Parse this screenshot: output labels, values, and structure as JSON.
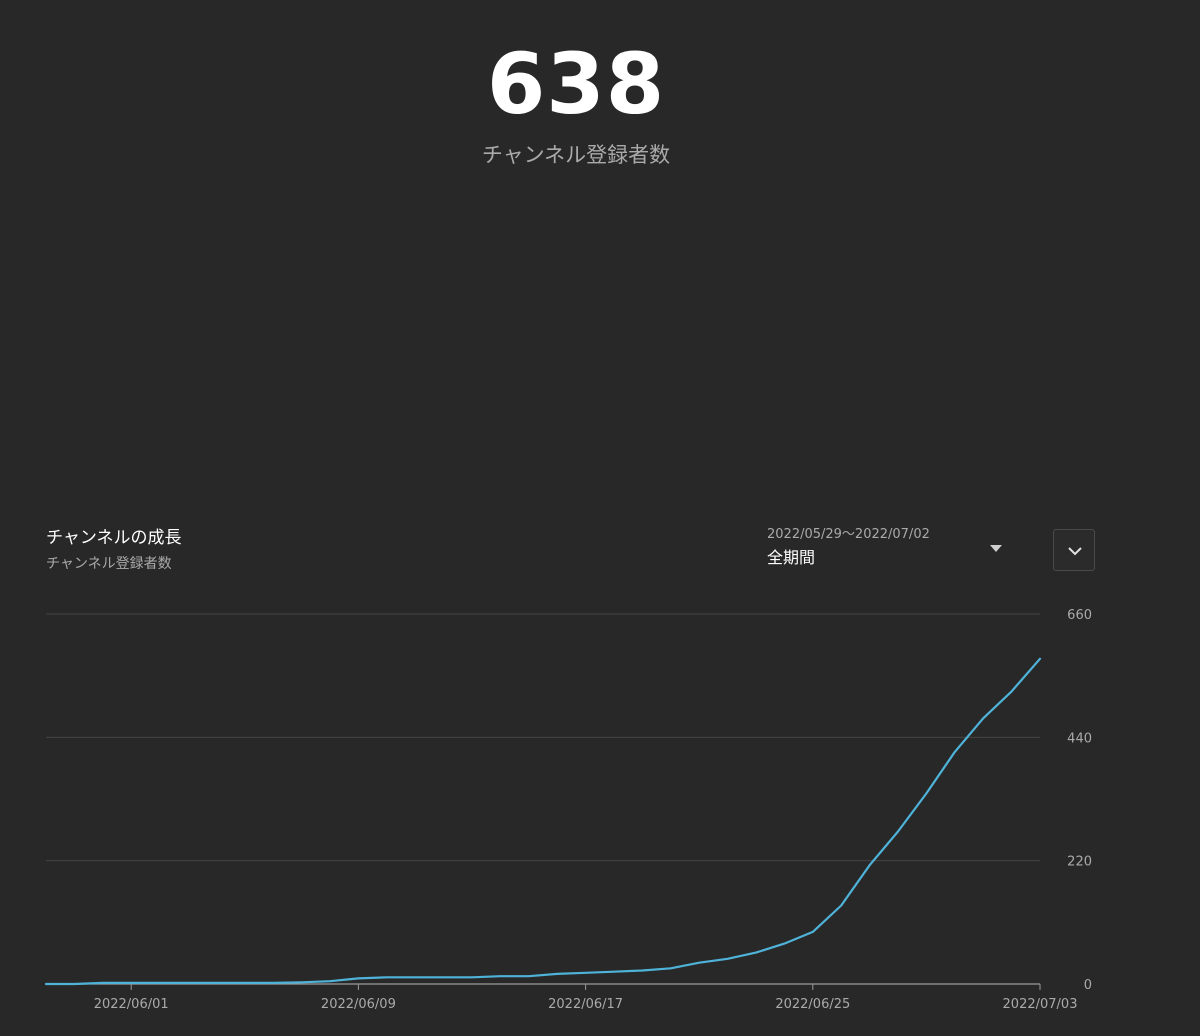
{
  "summary": {
    "value": "638",
    "label": "チャンネル登録者数"
  },
  "card": {
    "title": "チャンネルの成長",
    "subtitle": "チャンネル登録者数"
  },
  "range_select": {
    "dates": "2022/05/29〜2022/07/02",
    "value": "全期間"
  },
  "icons": {
    "range_caret": "caret-down-icon",
    "expand": "chevron-down-icon"
  },
  "colors": {
    "background": "#282828",
    "line": "#4fb3d9",
    "grid": "#444444",
    "axis_text": "#aaaaaa"
  },
  "chart_data": {
    "type": "line",
    "title": "チャンネルの成長",
    "subtitle": "チャンネル登録者数",
    "xlabel": "",
    "ylabel": "",
    "x_tick_labels": [
      "2022/06/01",
      "2022/06/09",
      "2022/06/17",
      "2022/06/25",
      "2022/07/03"
    ],
    "y_ticks": [
      0,
      220,
      440,
      660
    ],
    "ylim": [
      0,
      660
    ],
    "xlim": [
      "2022/05/29",
      "2022/07/03"
    ],
    "y_axis_position": "right",
    "grid": true,
    "legend": "none",
    "series": [
      {
        "x": [
          "2022/05/29",
          "2022/05/30",
          "2022/05/31",
          "2022/06/01",
          "2022/06/02",
          "2022/06/03",
          "2022/06/04",
          "2022/06/05",
          "2022/06/06",
          "2022/06/07",
          "2022/06/08",
          "2022/06/09",
          "2022/06/10",
          "2022/06/11",
          "2022/06/12",
          "2022/06/13",
          "2022/06/14",
          "2022/06/15",
          "2022/06/16",
          "2022/06/17",
          "2022/06/18",
          "2022/06/19",
          "2022/06/20",
          "2022/06/21",
          "2022/06/22",
          "2022/06/23",
          "2022/06/24",
          "2022/06/25",
          "2022/06/26",
          "2022/06/27",
          "2022/06/28",
          "2022/06/29",
          "2022/06/30",
          "2022/07/01",
          "2022/07/02",
          "2022/07/03"
        ],
        "values": [
          0,
          0,
          2,
          2,
          2,
          2,
          2,
          2,
          2,
          3,
          5,
          10,
          12,
          12,
          12,
          12,
          14,
          14,
          18,
          20,
          22,
          24,
          28,
          38,
          45,
          56,
          72,
          93,
          140,
          212,
          272,
          340,
          414,
          474,
          522,
          580
        ]
      }
    ]
  }
}
